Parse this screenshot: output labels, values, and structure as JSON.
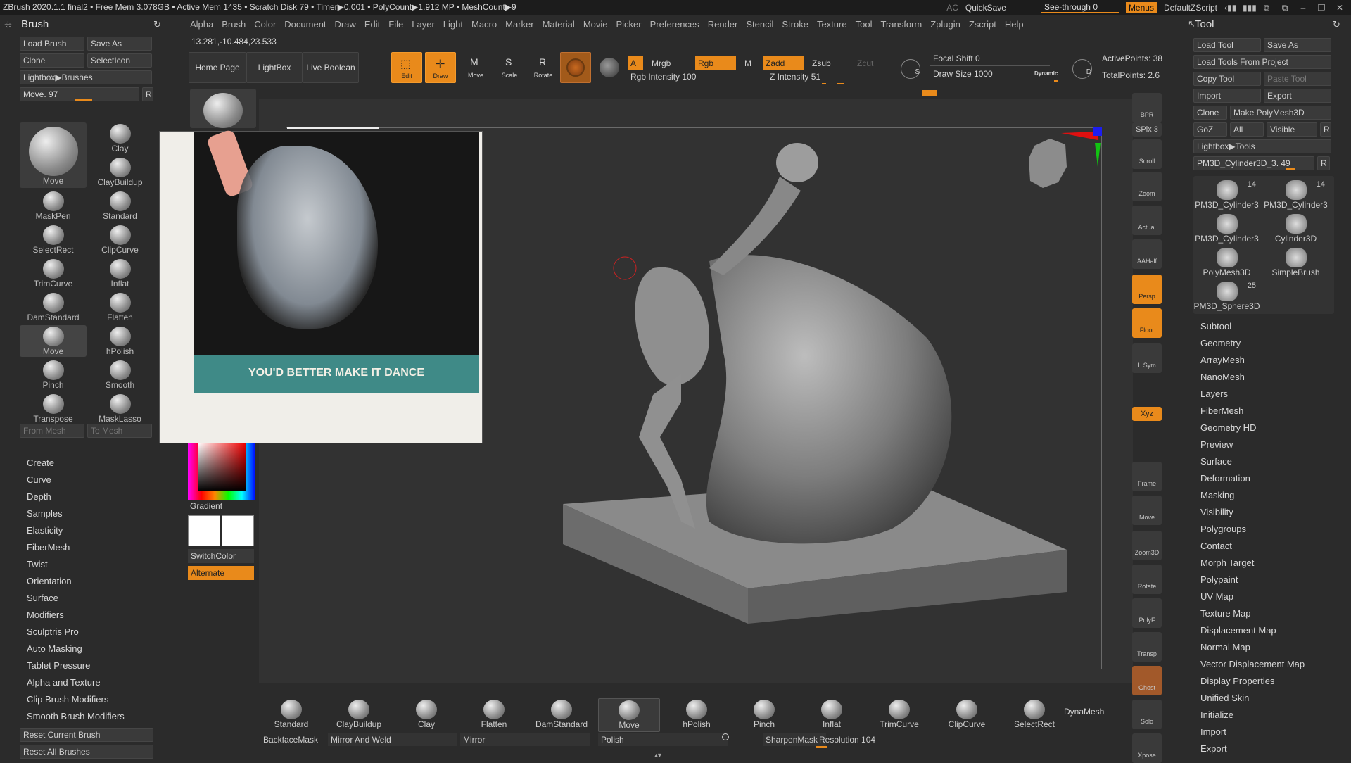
{
  "topbar": {
    "status": "ZBrush 2020.1.1    final2   • Free Mem 3.078GB • Active Mem 1435 • Scratch Disk 79 •  Timer▶0.001 • PolyCount▶1.912 MP  • MeshCount▶9",
    "ac": "AC",
    "quicksave": "QuickSave",
    "see_through": "See-through  0",
    "menus": "Menus",
    "script": "DefaultZScript"
  },
  "menubar": [
    "Alpha",
    "Brush",
    "Color",
    "Document",
    "Draw",
    "Edit",
    "File",
    "Layer",
    "Light",
    "Macro",
    "Marker",
    "Material",
    "Movie",
    "Picker",
    "Preferences",
    "Render",
    "Stencil",
    "Stroke",
    "Texture",
    "Tool",
    "Transform",
    "Zplugin",
    "Zscript",
    "Help"
  ],
  "coords": "13.281,-10.484,23.533",
  "left": {
    "title": "Brush",
    "load_brush": "Load Brush",
    "save_as": "Save As",
    "clone": "Clone",
    "select_icon": "SelectIcon",
    "lightbox_brushes": "Lightbox▶Brushes",
    "move_slider": "Move. 97",
    "move_fill_percent": 97,
    "r": "R",
    "big_brush": "Move",
    "brushes": [
      "Clay",
      "ClayBuildup",
      "MaskPen",
      "Standard",
      "SelectRect",
      "ClipCurve",
      "TrimCurve",
      "Inflat",
      "DamStandard",
      "Flatten",
      "Move",
      "hPolish",
      "Pinch",
      "Smooth",
      "Transpose",
      "MaskLasso"
    ],
    "from_mesh": "From Mesh",
    "to_mesh": "To Mesh",
    "sections": [
      "Create",
      "Curve",
      "Depth",
      "Samples",
      "Elasticity",
      "FiberMesh",
      "Twist",
      "Orientation",
      "Surface",
      "Modifiers",
      "Sculptris Pro",
      "Auto Masking",
      "Tablet Pressure",
      "Alpha and Texture",
      "Clip Brush Modifiers",
      "Smooth Brush Modifiers"
    ],
    "reset_current": "Reset Current Brush",
    "reset_all": "Reset All Brushes"
  },
  "reference": {
    "caption": "YOU'D BETTER MAKE IT DANCE"
  },
  "color": {
    "gradient": "Gradient",
    "switch": "SwitchColor",
    "alternate": "Alternate"
  },
  "toolbar": {
    "home": "Home Page",
    "lightbox": "LightBox",
    "live_boolean": "Live Boolean",
    "edit": "Edit",
    "draw": "Draw",
    "move": "Move",
    "scale": "Scale",
    "rotate": "Rotate",
    "a": "A",
    "mrgb": "Mrgb",
    "rgb": "Rgb",
    "m": "M",
    "zadd": "Zadd",
    "zsub": "Zsub",
    "zcut": "Zcut",
    "rgb_intensity": "Rgb Intensity 100",
    "rgb_intensity_value": 100,
    "z_intensity": "Z Intensity 51",
    "z_intensity_value": 51,
    "focal_shift": "Focal Shift 0",
    "focal_shift_value": 0,
    "draw_size": "Draw Size 1000",
    "draw_size_value": 1000,
    "dynamic": "Dynamic",
    "s": "S",
    "d": "D",
    "active_points": "ActivePoints: 38",
    "total_points": "TotalPoints: 2.6"
  },
  "rshelf": [
    "BPR",
    "SPix 3",
    "Scroll",
    "Zoom",
    "Actual",
    "AAHalf",
    "Persp",
    "Floor",
    "L.Sym",
    "",
    "Xyz",
    "",
    "",
    "Frame",
    "Move",
    "Zoom3D",
    "Rotate",
    "PolyF",
    "Transp",
    "Ghost",
    "Solo",
    "Xpose"
  ],
  "right": {
    "title": "Tool",
    "load_tool": "Load Tool",
    "save_as": "Save As",
    "load_from_project": "Load Tools From Project",
    "copy_tool": "Copy Tool",
    "paste_tool": "Paste Tool",
    "import": "Import",
    "export": "Export",
    "clone": "Clone",
    "make_polymesh": "Make PolyMesh3D",
    "goz": "GoZ",
    "all": "All",
    "visible": "Visible",
    "r": "R",
    "lightbox_tools": "Lightbox▶Tools",
    "current_tool": "PM3D_Cylinder3D_3. 49",
    "tools": [
      {
        "name": "PM3D_Cylinder3",
        "count": "14"
      },
      {
        "name": "PM3D_Cylinder3",
        "count": "14"
      },
      {
        "name": "PM3D_Cylinder3",
        "count": ""
      },
      {
        "name": "Cylinder3D",
        "count": ""
      },
      {
        "name": "PolyMesh3D",
        "count": ""
      },
      {
        "name": "SimpleBrush",
        "count": ""
      },
      {
        "name": "PM3D_Sphere3D",
        "count": "25"
      }
    ],
    "sections": [
      "Subtool",
      "Geometry",
      "ArrayMesh",
      "NanoMesh",
      "Layers",
      "FiberMesh",
      "Geometry HD",
      "Preview",
      "Surface",
      "Deformation",
      "Masking",
      "Visibility",
      "Polygroups",
      "Contact",
      "Morph Target",
      "Polypaint",
      "UV Map",
      "Texture Map",
      "Displacement Map",
      "Normal Map",
      "Vector Displacement Map",
      "Display Properties",
      "Unified Skin",
      "Initialize",
      "Import",
      "Export"
    ]
  },
  "bottom": {
    "brushes": [
      "Standard",
      "ClayBuildup",
      "Clay",
      "Flatten",
      "DamStandard",
      "Move",
      "hPolish",
      "Pinch",
      "Inflat",
      "TrimCurve",
      "ClipCurve",
      "SelectRect"
    ],
    "dynamesh": "DynaMesh",
    "backface": "BackfaceMask",
    "mirror_weld": "Mirror And Weld",
    "mirror": "Mirror",
    "polish": "Polish",
    "sharpen": "SharpenMask",
    "resolution": "Resolution 104",
    "resolution_value": 104
  },
  "colors": {
    "accent": "#e98a1b",
    "bg": "#2b2b2b",
    "canvas": "#323232"
  }
}
